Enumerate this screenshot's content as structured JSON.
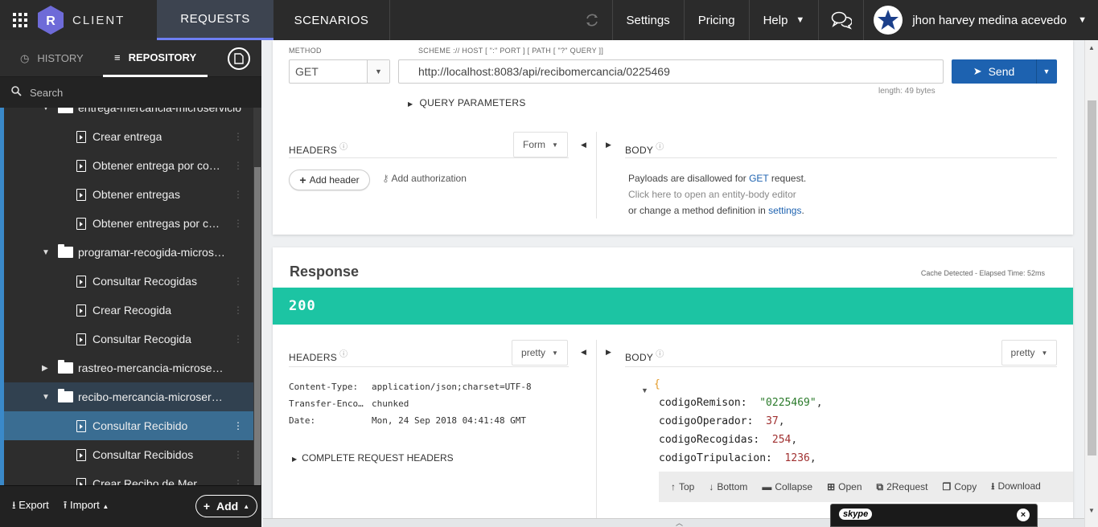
{
  "topbar": {
    "brand": "CLIENT",
    "tabs": [
      {
        "label": "REQUESTS"
      },
      {
        "label": "SCENARIOS"
      }
    ],
    "settings": "Settings",
    "pricing": "Pricing",
    "help": "Help",
    "user": "jhon harvey medina acevedo"
  },
  "sidebar": {
    "tab_history": "HISTORY",
    "tab_repository": "REPOSITORY",
    "search_placeholder": "Search",
    "tree": [
      {
        "type": "folder",
        "label": "entrega-mercancia-microservicio",
        "expanded": true
      },
      {
        "type": "request",
        "label": "Crear entrega"
      },
      {
        "type": "request",
        "label": "Obtener entrega por codigo"
      },
      {
        "type": "request",
        "label": "Obtener entregas"
      },
      {
        "type": "request",
        "label": "Obtener entregas por codigo"
      },
      {
        "type": "folder",
        "label": "programar-recogida-microservicio",
        "expanded": true
      },
      {
        "type": "request",
        "label": "Consultar Recogidas"
      },
      {
        "type": "request",
        "label": "Crear Recogida"
      },
      {
        "type": "request",
        "label": "Consultar Recogida"
      },
      {
        "type": "folder",
        "label": "rastreo-mercancia-microservicio",
        "expanded": false
      },
      {
        "type": "folder",
        "label": "recibo-mercancia-microservicio",
        "expanded": true
      },
      {
        "type": "request",
        "label": "Consultar Recibido",
        "selected": true
      },
      {
        "type": "request",
        "label": "Consultar Recibidos"
      },
      {
        "type": "request",
        "label": "Crear Recibo de Mercancia"
      }
    ],
    "export": "Export",
    "import": "Import",
    "add": "Add"
  },
  "request": {
    "method_label": "METHOD",
    "method": "GET",
    "scheme_label": "SCHEME :// HOST [ \":\" PORT ] [ PATH [ \"?\" QUERY ]]",
    "url": "http://localhost:8083/api/recibomercancia/0225469",
    "length": "length: 49 bytes",
    "send": "Send",
    "query_params": "QUERY PARAMETERS",
    "headers_label": "HEADERS",
    "headers_mode": "Form",
    "body_label": "BODY",
    "add_header": "Add header",
    "add_auth": "Add authorization",
    "payload_line1_pre": "Payloads are disallowed for ",
    "payload_line1_link": "GET",
    "payload_line1_post": " request.",
    "payload_line2": "Click here to open an entity-body editor",
    "payload_line3_pre": "or change a method definition in ",
    "payload_line3_link": "settings",
    "payload_line3_post": "."
  },
  "response": {
    "title": "Response",
    "cache": "Cache Detected - Elapsed Time: 52ms",
    "status": "200",
    "headers_label": "HEADERS",
    "headers_mode": "pretty",
    "body_label": "BODY",
    "body_mode": "pretty",
    "headers": [
      {
        "key": "Content-Type:",
        "value": "application/json;charset=UTF-8"
      },
      {
        "key": "Transfer-Encoding:",
        "value": "chunked"
      },
      {
        "key": "Date:",
        "value": "Mon, 24 Sep 2018 04:41:48 GMT"
      }
    ],
    "complete_headers": "COMPLETE REQUEST HEADERS",
    "json_open": "{",
    "json": [
      {
        "key": "codigoRemison:",
        "value": "\"0225469\"",
        "type": "s"
      },
      {
        "key": "codigoOperador:",
        "value": "37",
        "type": "n"
      },
      {
        "key": "codigoRecogidas:",
        "value": "254",
        "type": "n"
      },
      {
        "key": "codigoTripulacion:",
        "value": "1236",
        "type": "n"
      }
    ],
    "toolbar": {
      "top": "Top",
      "bottom": "Bottom",
      "collapse": "Collapse",
      "open": "Open",
      "to_request": "2Request",
      "copy": "Copy",
      "download": "Download"
    }
  },
  "skype": {
    "label": "skype"
  }
}
